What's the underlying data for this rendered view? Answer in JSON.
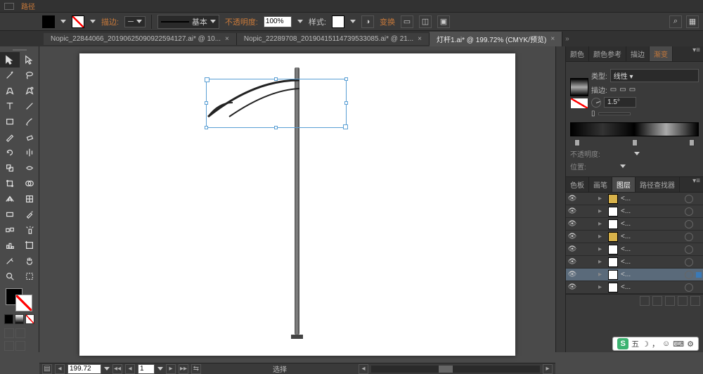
{
  "topbar": {
    "path_label": "路径"
  },
  "controlbar": {
    "stroke_label": "描边:",
    "stroke_style_label": "基本",
    "opacity_label": "不透明度:",
    "opacity_value": "100%",
    "style_label": "样式:",
    "transform_label": "变换"
  },
  "tabs": [
    {
      "label": "Nopic_22844066_20190625090922594127.ai* @ 10...",
      "active": false
    },
    {
      "label": "Nopic_22289708_20190415114739533085.ai* @ 21...",
      "active": false
    },
    {
      "label": "灯杆1.ai* @ 199.72% (CMYK/预览)",
      "active": true
    }
  ],
  "statusbar": {
    "zoom": "199.72",
    "page": "1",
    "mode": "选择"
  },
  "gradient_panel": {
    "tabs": [
      "颜色",
      "颜色参考",
      "描边"
    ],
    "active_tab": "渐变",
    "type_label": "类型:",
    "type_value": "线性",
    "stroke_label": "描边:",
    "angle_value": "1.5°",
    "ratio_label": "",
    "opacity_label": "不透明度:",
    "position_label": "位置:"
  },
  "layers_panel": {
    "tabs": [
      "色板",
      "画笔",
      "图层",
      "路径查找器"
    ],
    "active_tab": "图层",
    "layers": [
      {
        "thumb": "y",
        "name": "<..."
      },
      {
        "thumb": "w",
        "name": "<..."
      },
      {
        "thumb": "w",
        "name": "<..."
      },
      {
        "thumb": "y",
        "name": "<..."
      },
      {
        "thumb": "w",
        "name": "<..."
      },
      {
        "thumb": "w",
        "name": "<..."
      },
      {
        "thumb": "w",
        "name": "<...",
        "selected": true
      },
      {
        "thumb": "w",
        "name": "<..."
      }
    ]
  },
  "ime": {
    "label": "五",
    "moon": "☽",
    "comma": "，",
    "smile": "☺"
  }
}
